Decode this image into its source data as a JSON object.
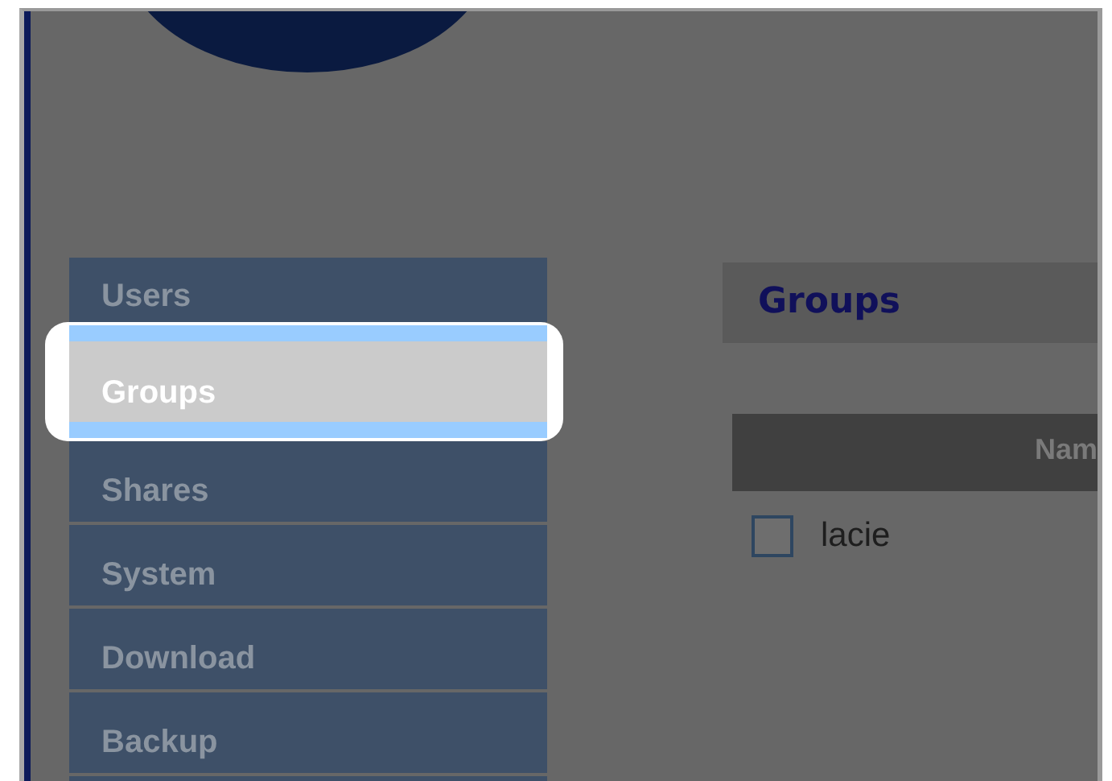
{
  "menu": [
    {
      "label": "Users",
      "selected": false
    },
    {
      "label": "Groups",
      "selected": true
    },
    {
      "label": "Shares",
      "selected": false
    },
    {
      "label": "System",
      "selected": false
    },
    {
      "label": "Download",
      "selected": false
    },
    {
      "label": "Backup",
      "selected": false
    },
    {
      "selected": false
    }
  ],
  "content": {
    "title": "Groups",
    "table": {
      "columns": [
        "Nam"
      ],
      "rows": [
        {
          "checked": false,
          "name": "lacie"
        }
      ]
    }
  }
}
